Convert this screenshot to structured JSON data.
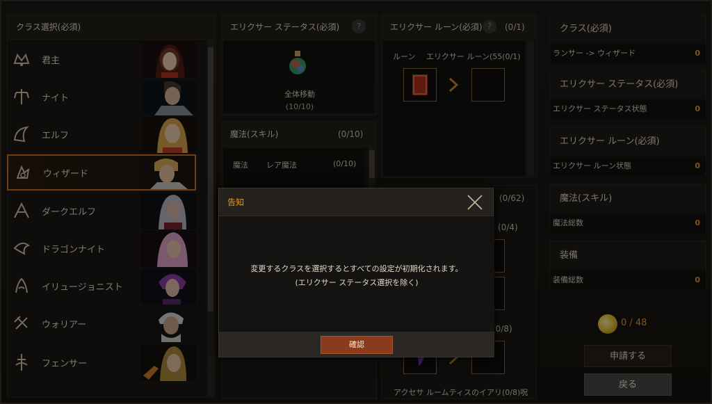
{
  "class_panel": {
    "title": "クラス選択(必須)",
    "classes": [
      {
        "name": "君主"
      },
      {
        "name": "ナイト"
      },
      {
        "name": "エルフ"
      },
      {
        "name": "ウィザード",
        "selected": true
      },
      {
        "name": "ダークエルフ"
      },
      {
        "name": "ドラゴンナイト"
      },
      {
        "name": "イリュージョニスト"
      },
      {
        "name": "ウォリアー"
      },
      {
        "name": "フェンサー"
      }
    ]
  },
  "elixir_status": {
    "title": "エリクサー ステータス(必須)",
    "item_label": "全体移動",
    "item_count": "(10/10)"
  },
  "magic": {
    "title": "魔法(スキル)",
    "count": "(0/10)",
    "row_label": "魔法",
    "row_sub": "レア魔法",
    "row_count": "(0/10)"
  },
  "elixir_rune": {
    "title": "エリクサー ルーン(必須)",
    "count": "(0/1)",
    "row_label": "ルーン",
    "row_sub": "エリクサー ルーン(55(0/1)"
  },
  "equipment_hidden": {
    "count_a": "(0/62)",
    "count_b": "(0/4)",
    "count_c": "リ(0/8)",
    "bottom_text": "アクセサ ルームティスのイアリ(0/8)呪"
  },
  "summary": {
    "sections": [
      {
        "title": "クラス(必須)",
        "row_label": "ランサー -> ウィザード",
        "row_value": "0"
      },
      {
        "title": "エリクサー ステータス(必須)",
        "row_label": "エリクサー ステータス状態",
        "row_value": "0"
      },
      {
        "title": "エリクサー ルーン(必須)",
        "row_label": "エリクサー ルーン状態",
        "row_value": "0"
      },
      {
        "title": "魔法(スキル)",
        "row_label": "魔法総数",
        "row_value": "0"
      },
      {
        "title": "装備",
        "row_label": "装備総数",
        "row_value": "0"
      }
    ],
    "gold": "0 / 48",
    "apply_label": "申請する",
    "back_label": "戻る"
  },
  "modal": {
    "title": "告知",
    "message_line1": "変更するクラスを選択するとすべての設定が初期化されます。",
    "message_line2": "(エリクサー ステータス選択を除く)",
    "confirm_label": "確認"
  },
  "colors": {
    "accent": "#e79a2a",
    "selected_border": "#c9761e",
    "confirm_button": "#8a3b1c"
  }
}
